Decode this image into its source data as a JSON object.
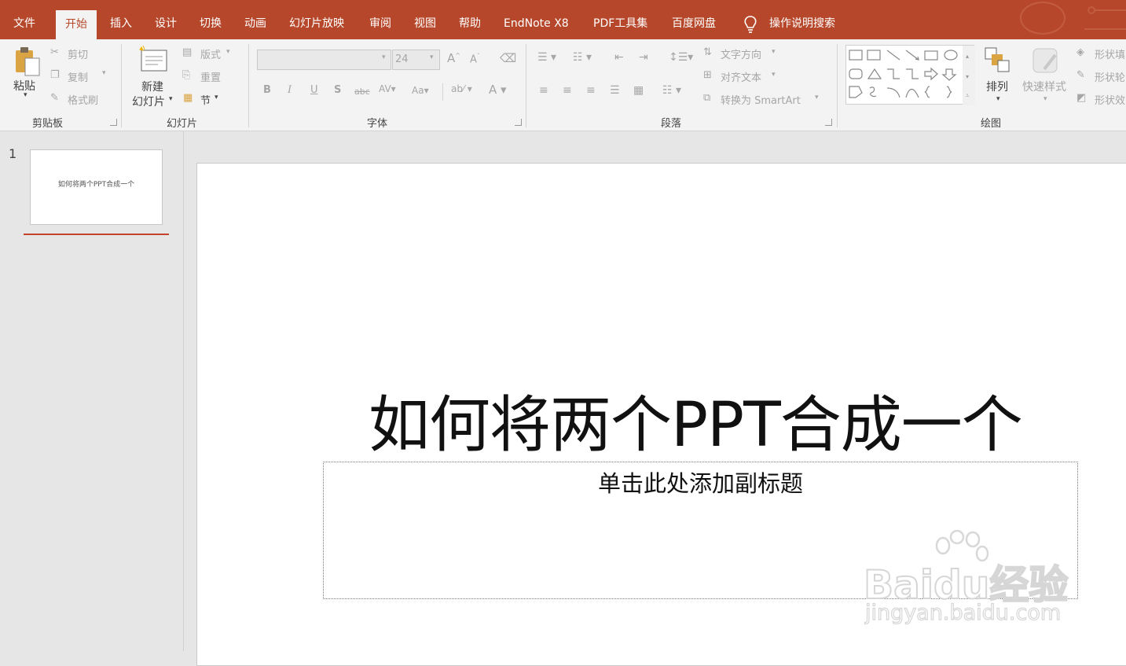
{
  "menu": {
    "tabs": [
      "文件",
      "开始",
      "插入",
      "设计",
      "切换",
      "动画",
      "幻灯片放映",
      "审阅",
      "视图",
      "帮助",
      "EndNote X8",
      "PDF工具集",
      "百度网盘"
    ],
    "active": "开始",
    "tell_me": "操作说明搜索"
  },
  "ribbon": {
    "clipboard": {
      "label": "剪贴板",
      "paste": "粘贴",
      "cut": "剪切",
      "copy": "复制",
      "format_painter": "格式刷"
    },
    "slides": {
      "label": "幻灯片",
      "new_slide_1": "新建",
      "new_slide_2": "幻灯片",
      "layout": "版式",
      "reset": "重置",
      "section": "节"
    },
    "font": {
      "label": "字体",
      "font_name": "",
      "font_size": "24"
    },
    "paragraph": {
      "label": "段落",
      "text_direction": "文字方向",
      "align_text": "对齐文本",
      "convert_smartart": "转换为 SmartArt"
    },
    "drawing": {
      "label": "绘图",
      "arrange": "排列",
      "quick_styles": "快速样式",
      "shape_fill": "形状填",
      "shape_outline": "形状轮",
      "shape_effects": "形状效"
    }
  },
  "thumbnails": [
    {
      "number": "1",
      "title": "如何将两个PPT合成一个"
    }
  ],
  "slide": {
    "title": "如何将两个PPT合成一个",
    "subtitle_placeholder": "单击此处添加副标题"
  },
  "watermark": {
    "brand": "Baidu经验",
    "url": "jingyan.baidu.com"
  },
  "colors": {
    "accent": "#b7472a",
    "ribbon_bg": "#f3f3f3",
    "workspace_bg": "#e6e6e6"
  }
}
